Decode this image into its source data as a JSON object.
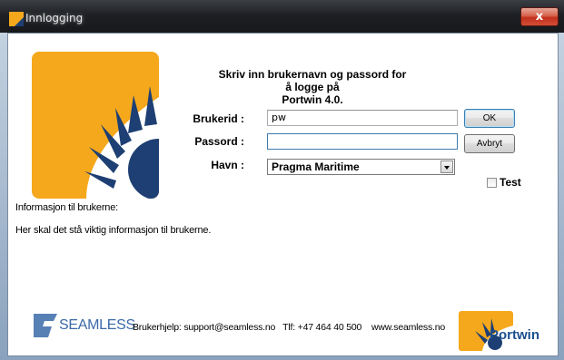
{
  "window": {
    "title": "Innlogging",
    "close_label": "x"
  },
  "login": {
    "prompt_line1": "Skriv inn brukernavn og passord for å logge på",
    "prompt_line2": "Portwin 4.0.",
    "user_label": "Brukerid :",
    "user_value": "pw",
    "password_label": "Passord :",
    "password_value": "",
    "harbor_label": "Havn :",
    "harbor_value": "Pragma Maritime",
    "ok_label": "OK",
    "cancel_label": "Avbryt",
    "test_label": "Test",
    "test_checked": false
  },
  "info": {
    "heading": "Informasjon til brukerne:",
    "message": "Her skal det stå viktig informasjon til brukerne."
  },
  "footer": {
    "seamless_logo_text": "SEAMLESS",
    "support_text": "Brukerhjelp: support@seamless.no   Tlf: +47 464 40 500    www.seamless.no",
    "portwin_logo_text": "Portwin"
  },
  "colors": {
    "logo_orange": "#f5a81c",
    "logo_blue": "#1d3f73",
    "seamless_blue": "#3a6aa8",
    "title_bar": "#1e2024",
    "close_red": "#c3301c"
  }
}
